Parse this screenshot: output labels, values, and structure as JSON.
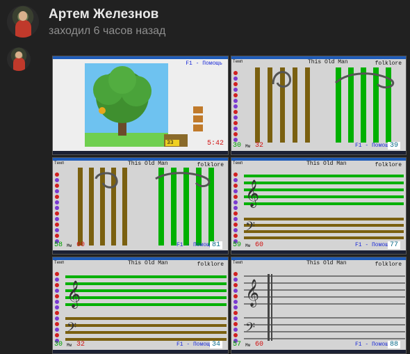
{
  "profile": {
    "name": "Артем Железнов",
    "status": "заходил 6 часов назад"
  },
  "colors": {
    "green_bar": "#00b000",
    "brown_bar": "#7a6010",
    "blue_label": "#1a2ad8",
    "red_label": "#d01010",
    "tile_bg": "#d4d4d4"
  },
  "tiles": [
    {
      "help": "F1 - Помощь",
      "timer": "5:42",
      "chest_value": "33"
    },
    {
      "song": "This Old Man",
      "genre": "folklore",
      "tempo": "Темп",
      "left_num": "30",
      "mid_label": "Мм",
      "mid_num": "32",
      "help": "F1 - Помощь",
      "score": "39"
    },
    {
      "song": "This Old Man",
      "genre": "folklore",
      "tempo": "Темп",
      "left_num": "58",
      "mid_label": "Мм",
      "mid_num": "60",
      "help": "F1 - Помощь",
      "score": "81"
    },
    {
      "song": "This Old Man",
      "genre": "folklore",
      "tempo": "Темп",
      "left_num": "59",
      "mid_label": "Мм",
      "mid_num": "60",
      "help": "F1 - Помощь",
      "score": "77"
    },
    {
      "song": "This Old Man",
      "genre": "folklore",
      "tempo": "Темп",
      "left_num": "30",
      "mid_label": "Мм",
      "mid_num": "32",
      "help": "F1 - Помощь",
      "score": "34"
    },
    {
      "song": "This Old Man",
      "genre": "folklore",
      "tempo": "Темп",
      "left_num": "57",
      "mid_label": "Мм",
      "mid_num": "60",
      "help": "F1 - Помощь",
      "score": "88"
    }
  ]
}
